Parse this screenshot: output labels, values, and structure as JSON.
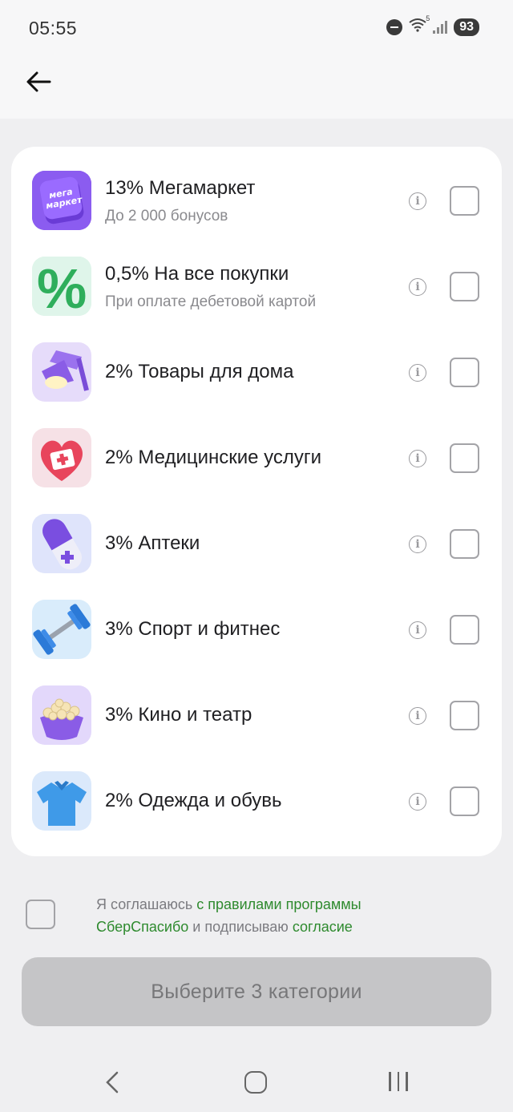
{
  "status_bar": {
    "time": "05:55",
    "wifi_badge": "5",
    "battery": "93"
  },
  "categories": [
    {
      "title": "13% Мегамаркет",
      "subtitle": "До 2 000 бонусов",
      "icon": "megamarket-logo-icon",
      "logo_text_1": "мега",
      "logo_text_2": "маркет"
    },
    {
      "title": "0,5% На все покупки",
      "subtitle": "При оплате дебетовой картой",
      "icon": "percent-icon",
      "symbol": "%"
    },
    {
      "title": "2% Товары для дома",
      "subtitle": "",
      "icon": "lamp-icon"
    },
    {
      "title": "2% Медицинские услуги",
      "subtitle": "",
      "icon": "heart-medical-icon"
    },
    {
      "title": "3% Аптеки",
      "subtitle": "",
      "icon": "pill-icon"
    },
    {
      "title": "3% Спорт и фитнес",
      "subtitle": "",
      "icon": "dumbbell-icon"
    },
    {
      "title": "3% Кино и театр",
      "subtitle": "",
      "icon": "popcorn-icon"
    },
    {
      "title": "2% Одежда и обувь",
      "subtitle": "",
      "icon": "shirt-icon"
    }
  ],
  "agreement": {
    "part1": "Я соглашаюсь ",
    "link1": "с правилами программы СберСпасибо",
    "part2": " и подписываю ",
    "link2": "согласие"
  },
  "cta_label": "Выберите 3 категории",
  "colors": {
    "link_green": "#2e8a2e",
    "cta_disabled": "#c5c5c7",
    "megamarket_purple": "#7b4ce0"
  }
}
